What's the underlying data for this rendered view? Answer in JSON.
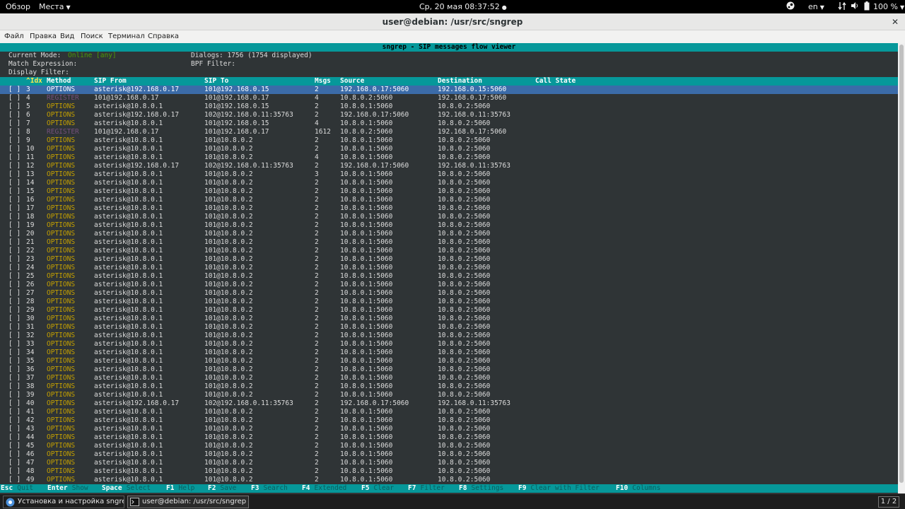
{
  "topbar": {
    "activities": "Обзор",
    "places": "Места",
    "clock": "Ср, 20 мая  08:37:52",
    "lang": "en",
    "battery": "100 %"
  },
  "window": {
    "title": "user@debian: /usr/src/sngrep",
    "close_glyph": "✕"
  },
  "menu": [
    "Файл",
    "Правка",
    "Вид",
    "Поиск",
    "Терминал",
    "Справка"
  ],
  "app": {
    "title": "sngrep - SIP messages flow viewer",
    "mode_label": "Current Mode:",
    "mode_value": "Online [any]",
    "dialogs": "Dialogs: 1756 (1754 displayed)",
    "match_label": "Match Expression:",
    "bpf_label": "BPF Filter:",
    "display_filter_label": "Display Filter:"
  },
  "columns": {
    "idx": "^Idx",
    "method": "Method",
    "from": "SIP From",
    "to": "SIP To",
    "msgs": "Msgs",
    "source": "Source",
    "destination": "Destination",
    "state": "Call State"
  },
  "rows": [
    {
      "c": "[ ]",
      "i": "3",
      "m": "OPTIONS",
      "f": "asterisk@192.168.0.17",
      "t": "101@192.168.0.15",
      "n": "2",
      "s": "192.168.0.17:5060",
      "d": "192.168.0.15:5060"
    },
    {
      "c": "[ ]",
      "i": "4",
      "m": "REGISTER",
      "f": "101@192.168.0.17",
      "t": "101@192.168.0.17",
      "n": "4",
      "s": "10.8.0.2:5060",
      "d": "192.168.0.17:5060"
    },
    {
      "c": "[ ]",
      "i": "5",
      "m": "OPTIONS",
      "f": "asterisk@10.8.0.1",
      "t": "101@192.168.0.15",
      "n": "2",
      "s": "10.8.0.1:5060",
      "d": "10.8.0.2:5060"
    },
    {
      "c": "[ ]",
      "i": "6",
      "m": "OPTIONS",
      "f": "asterisk@192.168.0.17",
      "t": "102@192.168.0.11:35763",
      "n": "2",
      "s": "192.168.0.17:5060",
      "d": "192.168.0.11:35763"
    },
    {
      "c": "[ ]",
      "i": "7",
      "m": "OPTIONS",
      "f": "asterisk@10.8.0.1",
      "t": "101@192.168.0.15",
      "n": "4",
      "s": "10.8.0.1:5060",
      "d": "10.8.0.2:5060"
    },
    {
      "c": "[ ]",
      "i": "8",
      "m": "REGISTER",
      "f": "101@192.168.0.17",
      "t": "101@192.168.0.17",
      "n": "1612",
      "s": "10.8.0.2:5060",
      "d": "192.168.0.17:5060"
    },
    {
      "c": "[ ]",
      "i": "9",
      "m": "OPTIONS",
      "f": "asterisk@10.8.0.1",
      "t": "101@10.8.0.2",
      "n": "2",
      "s": "10.8.0.1:5060",
      "d": "10.8.0.2:5060"
    },
    {
      "c": "[ ]",
      "i": "10",
      "m": "OPTIONS",
      "f": "asterisk@10.8.0.1",
      "t": "101@10.8.0.2",
      "n": "2",
      "s": "10.8.0.1:5060",
      "d": "10.8.0.2:5060"
    },
    {
      "c": "[ ]",
      "i": "11",
      "m": "OPTIONS",
      "f": "asterisk@10.8.0.1",
      "t": "101@10.8.0.2",
      "n": "4",
      "s": "10.8.0.1:5060",
      "d": "10.8.0.2:5060"
    },
    {
      "c": "[ ]",
      "i": "12",
      "m": "OPTIONS",
      "f": "asterisk@192.168.0.17",
      "t": "102@192.168.0.11:35763",
      "n": "2",
      "s": "192.168.0.17:5060",
      "d": "192.168.0.11:35763"
    },
    {
      "c": "[ ]",
      "i": "13",
      "m": "OPTIONS",
      "f": "asterisk@10.8.0.1",
      "t": "101@10.8.0.2",
      "n": "3",
      "s": "10.8.0.1:5060",
      "d": "10.8.0.2:5060"
    },
    {
      "c": "[ ]",
      "i": "14",
      "m": "OPTIONS",
      "f": "asterisk@10.8.0.1",
      "t": "101@10.8.0.2",
      "n": "2",
      "s": "10.8.0.1:5060",
      "d": "10.8.0.2:5060"
    },
    {
      "c": "[ ]",
      "i": "15",
      "m": "OPTIONS",
      "f": "asterisk@10.8.0.1",
      "t": "101@10.8.0.2",
      "n": "2",
      "s": "10.8.0.1:5060",
      "d": "10.8.0.2:5060"
    },
    {
      "c": "[ ]",
      "i": "16",
      "m": "OPTIONS",
      "f": "asterisk@10.8.0.1",
      "t": "101@10.8.0.2",
      "n": "2",
      "s": "10.8.0.1:5060",
      "d": "10.8.0.2:5060"
    },
    {
      "c": "[ ]",
      "i": "17",
      "m": "OPTIONS",
      "f": "asterisk@10.8.0.1",
      "t": "101@10.8.0.2",
      "n": "2",
      "s": "10.8.0.1:5060",
      "d": "10.8.0.2:5060"
    },
    {
      "c": "[ ]",
      "i": "18",
      "m": "OPTIONS",
      "f": "asterisk@10.8.0.1",
      "t": "101@10.8.0.2",
      "n": "2",
      "s": "10.8.0.1:5060",
      "d": "10.8.0.2:5060"
    },
    {
      "c": "[ ]",
      "i": "19",
      "m": "OPTIONS",
      "f": "asterisk@10.8.0.1",
      "t": "101@10.8.0.2",
      "n": "2",
      "s": "10.8.0.1:5060",
      "d": "10.8.0.2:5060"
    },
    {
      "c": "[ ]",
      "i": "20",
      "m": "OPTIONS",
      "f": "asterisk@10.8.0.1",
      "t": "101@10.8.0.2",
      "n": "2",
      "s": "10.8.0.1:5060",
      "d": "10.8.0.2:5060"
    },
    {
      "c": "[ ]",
      "i": "21",
      "m": "OPTIONS",
      "f": "asterisk@10.8.0.1",
      "t": "101@10.8.0.2",
      "n": "2",
      "s": "10.8.0.1:5060",
      "d": "10.8.0.2:5060"
    },
    {
      "c": "[ ]",
      "i": "22",
      "m": "OPTIONS",
      "f": "asterisk@10.8.0.1",
      "t": "101@10.8.0.2",
      "n": "2",
      "s": "10.8.0.1:5060",
      "d": "10.8.0.2:5060"
    },
    {
      "c": "[ ]",
      "i": "23",
      "m": "OPTIONS",
      "f": "asterisk@10.8.0.1",
      "t": "101@10.8.0.2",
      "n": "2",
      "s": "10.8.0.1:5060",
      "d": "10.8.0.2:5060"
    },
    {
      "c": "[ ]",
      "i": "24",
      "m": "OPTIONS",
      "f": "asterisk@10.8.0.1",
      "t": "101@10.8.0.2",
      "n": "2",
      "s": "10.8.0.1:5060",
      "d": "10.8.0.2:5060"
    },
    {
      "c": "[ ]",
      "i": "25",
      "m": "OPTIONS",
      "f": "asterisk@10.8.0.1",
      "t": "101@10.8.0.2",
      "n": "2",
      "s": "10.8.0.1:5060",
      "d": "10.8.0.2:5060"
    },
    {
      "c": "[ ]",
      "i": "26",
      "m": "OPTIONS",
      "f": "asterisk@10.8.0.1",
      "t": "101@10.8.0.2",
      "n": "2",
      "s": "10.8.0.1:5060",
      "d": "10.8.0.2:5060"
    },
    {
      "c": "[ ]",
      "i": "27",
      "m": "OPTIONS",
      "f": "asterisk@10.8.0.1",
      "t": "101@10.8.0.2",
      "n": "2",
      "s": "10.8.0.1:5060",
      "d": "10.8.0.2:5060"
    },
    {
      "c": "[ ]",
      "i": "28",
      "m": "OPTIONS",
      "f": "asterisk@10.8.0.1",
      "t": "101@10.8.0.2",
      "n": "2",
      "s": "10.8.0.1:5060",
      "d": "10.8.0.2:5060"
    },
    {
      "c": "[ ]",
      "i": "29",
      "m": "OPTIONS",
      "f": "asterisk@10.8.0.1",
      "t": "101@10.8.0.2",
      "n": "2",
      "s": "10.8.0.1:5060",
      "d": "10.8.0.2:5060"
    },
    {
      "c": "[ ]",
      "i": "30",
      "m": "OPTIONS",
      "f": "asterisk@10.8.0.1",
      "t": "101@10.8.0.2",
      "n": "2",
      "s": "10.8.0.1:5060",
      "d": "10.8.0.2:5060"
    },
    {
      "c": "[ ]",
      "i": "31",
      "m": "OPTIONS",
      "f": "asterisk@10.8.0.1",
      "t": "101@10.8.0.2",
      "n": "2",
      "s": "10.8.0.1:5060",
      "d": "10.8.0.2:5060"
    },
    {
      "c": "[ ]",
      "i": "32",
      "m": "OPTIONS",
      "f": "asterisk@10.8.0.1",
      "t": "101@10.8.0.2",
      "n": "2",
      "s": "10.8.0.1:5060",
      "d": "10.8.0.2:5060"
    },
    {
      "c": "[ ]",
      "i": "33",
      "m": "OPTIONS",
      "f": "asterisk@10.8.0.1",
      "t": "101@10.8.0.2",
      "n": "2",
      "s": "10.8.0.1:5060",
      "d": "10.8.0.2:5060"
    },
    {
      "c": "[ ]",
      "i": "34",
      "m": "OPTIONS",
      "f": "asterisk@10.8.0.1",
      "t": "101@10.8.0.2",
      "n": "2",
      "s": "10.8.0.1:5060",
      "d": "10.8.0.2:5060"
    },
    {
      "c": "[ ]",
      "i": "35",
      "m": "OPTIONS",
      "f": "asterisk@10.8.0.1",
      "t": "101@10.8.0.2",
      "n": "2",
      "s": "10.8.0.1:5060",
      "d": "10.8.0.2:5060"
    },
    {
      "c": "[ ]",
      "i": "36",
      "m": "OPTIONS",
      "f": "asterisk@10.8.0.1",
      "t": "101@10.8.0.2",
      "n": "2",
      "s": "10.8.0.1:5060",
      "d": "10.8.0.2:5060"
    },
    {
      "c": "[ ]",
      "i": "37",
      "m": "OPTIONS",
      "f": "asterisk@10.8.0.1",
      "t": "101@10.8.0.2",
      "n": "2",
      "s": "10.8.0.1:5060",
      "d": "10.8.0.2:5060"
    },
    {
      "c": "[ ]",
      "i": "38",
      "m": "OPTIONS",
      "f": "asterisk@10.8.0.1",
      "t": "101@10.8.0.2",
      "n": "2",
      "s": "10.8.0.1:5060",
      "d": "10.8.0.2:5060"
    },
    {
      "c": "[ ]",
      "i": "39",
      "m": "OPTIONS",
      "f": "asterisk@10.8.0.1",
      "t": "101@10.8.0.2",
      "n": "2",
      "s": "10.8.0.1:5060",
      "d": "10.8.0.2:5060"
    },
    {
      "c": "[ ]",
      "i": "40",
      "m": "OPTIONS",
      "f": "asterisk@192.168.0.17",
      "t": "102@192.168.0.11:35763",
      "n": "2",
      "s": "192.168.0.17:5060",
      "d": "192.168.0.11:35763"
    },
    {
      "c": "[ ]",
      "i": "41",
      "m": "OPTIONS",
      "f": "asterisk@10.8.0.1",
      "t": "101@10.8.0.2",
      "n": "2",
      "s": "10.8.0.1:5060",
      "d": "10.8.0.2:5060"
    },
    {
      "c": "[ ]",
      "i": "42",
      "m": "OPTIONS",
      "f": "asterisk@10.8.0.1",
      "t": "101@10.8.0.2",
      "n": "2",
      "s": "10.8.0.1:5060",
      "d": "10.8.0.2:5060"
    },
    {
      "c": "[ ]",
      "i": "43",
      "m": "OPTIONS",
      "f": "asterisk@10.8.0.1",
      "t": "101@10.8.0.2",
      "n": "2",
      "s": "10.8.0.1:5060",
      "d": "10.8.0.2:5060"
    },
    {
      "c": "[ ]",
      "i": "44",
      "m": "OPTIONS",
      "f": "asterisk@10.8.0.1",
      "t": "101@10.8.0.2",
      "n": "2",
      "s": "10.8.0.1:5060",
      "d": "10.8.0.2:5060"
    },
    {
      "c": "[ ]",
      "i": "45",
      "m": "OPTIONS",
      "f": "asterisk@10.8.0.1",
      "t": "101@10.8.0.2",
      "n": "2",
      "s": "10.8.0.1:5060",
      "d": "10.8.0.2:5060"
    },
    {
      "c": "[ ]",
      "i": "46",
      "m": "OPTIONS",
      "f": "asterisk@10.8.0.1",
      "t": "101@10.8.0.2",
      "n": "2",
      "s": "10.8.0.1:5060",
      "d": "10.8.0.2:5060"
    },
    {
      "c": "[ ]",
      "i": "47",
      "m": "OPTIONS",
      "f": "asterisk@10.8.0.1",
      "t": "101@10.8.0.2",
      "n": "2",
      "s": "10.8.0.1:5060",
      "d": "10.8.0.2:5060"
    },
    {
      "c": "[ ]",
      "i": "48",
      "m": "OPTIONS",
      "f": "asterisk@10.8.0.1",
      "t": "101@10.8.0.2",
      "n": "2",
      "s": "10.8.0.1:5060",
      "d": "10.8.0.2:5060"
    },
    {
      "c": "[ ]",
      "i": "49",
      "m": "OPTIONS",
      "f": "asterisk@10.8.0.1",
      "t": "101@10.8.0.2",
      "n": "2",
      "s": "10.8.0.1:5060",
      "d": "10.8.0.2:5060"
    }
  ],
  "footer": [
    {
      "key": "Esc",
      "action": "Quit"
    },
    {
      "key": "Enter",
      "action": "Show"
    },
    {
      "key": "Space",
      "action": "Select"
    },
    {
      "key": "F1",
      "action": "Help"
    },
    {
      "key": "F2",
      "action": "Save"
    },
    {
      "key": "F3",
      "action": "Search"
    },
    {
      "key": "F4",
      "action": "Extended"
    },
    {
      "key": "F5",
      "action": "Clear"
    },
    {
      "key": "F7",
      "action": "Filter"
    },
    {
      "key": "F8",
      "action": "Settings"
    },
    {
      "key": "F9",
      "action": "Clear with Filter"
    },
    {
      "key": "F10",
      "action": "Columns"
    }
  ],
  "taskbar": {
    "task1": "Установка и настройка sngrep дл...",
    "task2": "user@debian: /usr/src/sngrep",
    "pager": "1 / 2"
  },
  "colors": {
    "terminal_bg": "#2f3436",
    "teal_bar": "#06989a",
    "selected_row": "#3b6ba8",
    "method_options": "#c4a000",
    "method_register": "#75507b"
  },
  "selected_index": 0
}
